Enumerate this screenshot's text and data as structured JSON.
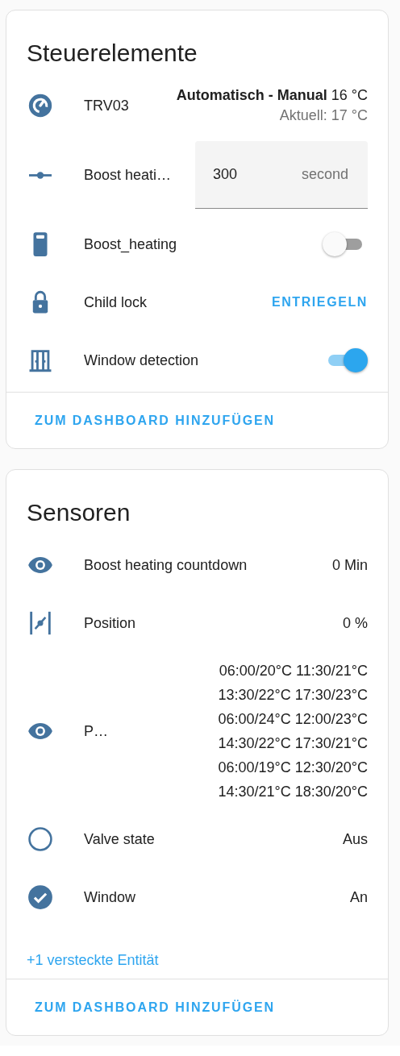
{
  "cards": [
    {
      "title": "Steuerelemente",
      "rows": [
        {
          "kind": "climate",
          "name": "TRV03",
          "state": "**Automatisch - Manual** 16 °C",
          "current": "Aktuell: 17 °C"
        },
        {
          "kind": "number",
          "name": "Boost heati…",
          "value": "300",
          "unit": "second"
        },
        {
          "kind": "switch",
          "name": "Boost_heating",
          "on": false
        },
        {
          "kind": "button",
          "name": "Child lock",
          "action": "ENTRIEGELN"
        },
        {
          "kind": "switch",
          "name": "Window detection",
          "on": true
        }
      ],
      "footer": "ZUM DASHBOARD HINZUFÜGEN"
    },
    {
      "title": "Sensoren",
      "rows": [
        {
          "kind": "sensor",
          "name": "Boost heating countdown",
          "value": "0 Min"
        },
        {
          "kind": "sensor",
          "name": "Position",
          "value": "0 %"
        },
        {
          "kind": "multiline",
          "name": "P…",
          "value_lines": [
            "06:00/20°C 11:30/21°C",
            "13:30/22°C 17:30/23°C",
            "06:00/24°C 12:00/23°C",
            "14:30/22°C 17:30/21°C",
            "06:00/19°C 12:30/20°C",
            "14:30/21°C 18:30/20°C"
          ]
        },
        {
          "kind": "binary",
          "name": "Valve state",
          "value": "Aus",
          "on": false
        },
        {
          "kind": "binary",
          "name": "Window",
          "value": "An",
          "on": true
        }
      ],
      "hidden_link": "+1 versteckte Entität",
      "footer": "ZUM DASHBOARD HINZUFÜGEN"
    }
  ]
}
